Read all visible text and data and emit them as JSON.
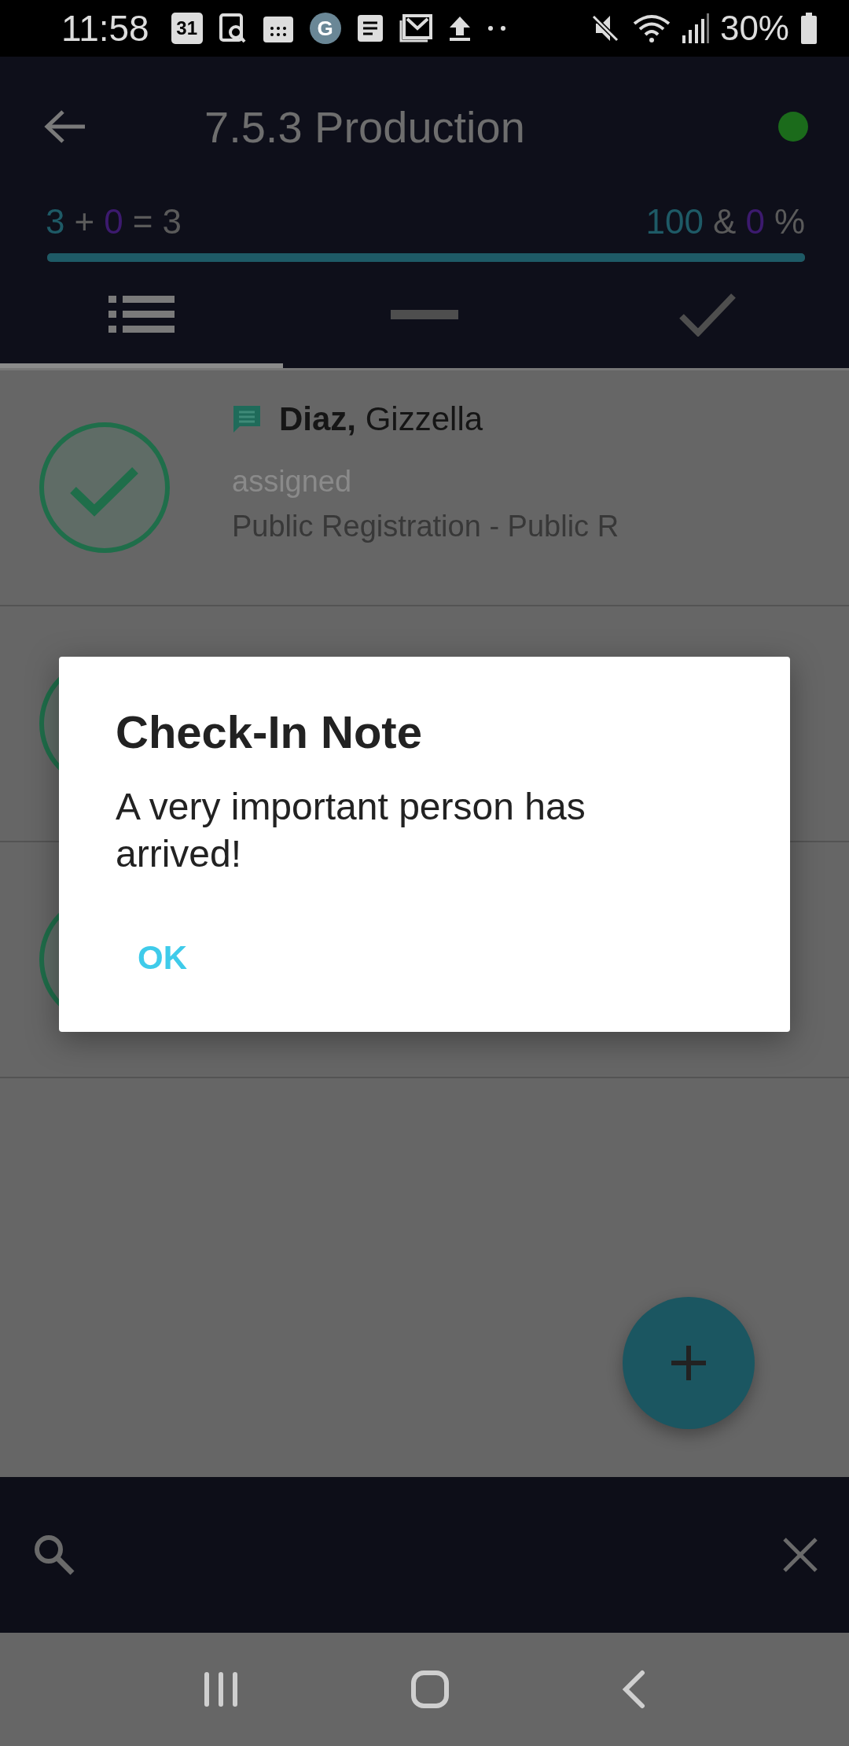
{
  "status_bar": {
    "time": "11:58",
    "notifications": [
      {
        "kind": "calendar",
        "text": "31"
      },
      {
        "kind": "doc-search"
      },
      {
        "kind": "calendar-grid"
      },
      {
        "kind": "gear",
        "text": "G"
      },
      {
        "kind": "document"
      },
      {
        "kind": "mail"
      },
      {
        "kind": "upload"
      },
      {
        "kind": "more"
      }
    ],
    "battery": "30%"
  },
  "header": {
    "title": "7.5.3 Production",
    "connected": true,
    "stats_left": [
      {
        "text": "3",
        "kind": "checked"
      },
      {
        "text": "+",
        "kind": "symbol"
      },
      {
        "text": "0",
        "kind": "added"
      },
      {
        "text": "=",
        "kind": "symbol"
      },
      {
        "text": "3",
        "kind": "total"
      }
    ],
    "stats_right": [
      {
        "text": "100",
        "kind": "checked"
      },
      {
        "text": "&",
        "kind": "symbol"
      },
      {
        "text": "0",
        "kind": "added"
      },
      {
        "text": "%",
        "kind": "symbol"
      }
    ],
    "progress": {
      "level": 1.0
    },
    "tabs": [
      {
        "kind": "list",
        "selected": true
      },
      {
        "kind": "minus",
        "selected": false
      },
      {
        "kind": "check",
        "selected": false
      }
    ]
  },
  "attendees": [
    {
      "checked_in": true,
      "has_note": true,
      "last_name": "Diaz,",
      "first_name": "Gizzella",
      "status": "assigned",
      "detail": "Public Registration - Public R"
    },
    {
      "checked_in": true,
      "has_note": false
    },
    {
      "checked_in": true,
      "has_note": false
    }
  ],
  "dialog": {
    "title": "Check-In Note",
    "message": "A very important person has arrived!",
    "buttons": [
      "OK"
    ]
  },
  "search_bar": {
    "clearable": true
  }
}
